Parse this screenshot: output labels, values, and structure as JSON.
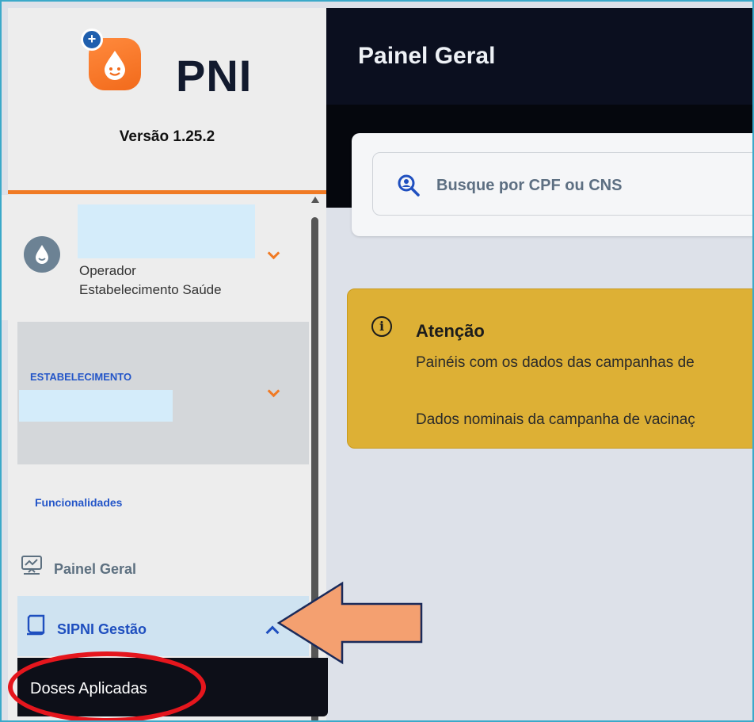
{
  "app": {
    "logo_text": "PNI",
    "version": "Versão 1.25.2"
  },
  "user": {
    "role_line1": "Operador",
    "role_line2": "Estabelecimento Saúde"
  },
  "establishment": {
    "title": "ESTABELECIMENTO"
  },
  "sidebar": {
    "section_title": "Funcionalidades",
    "items": [
      {
        "label": "Painel Geral",
        "icon": "dashboard-icon"
      },
      {
        "label": "SIPNI Gestão",
        "icon": "document-icon",
        "expanded": true
      },
      {
        "label": "Doses Aplicadas",
        "highlighted": true
      }
    ]
  },
  "header": {
    "title": "Painel Geral"
  },
  "search": {
    "placeholder": "Busque por CPF ou CNS",
    "icon": "person-search-icon"
  },
  "alert": {
    "title": "Atenção",
    "line1": "Painéis com os dados das campanhas de",
    "line2": "Dados nominais da campanha de vacinaç",
    "icon": "info-icon",
    "color": "#ddb035"
  },
  "colors": {
    "accent_orange": "#f07a24",
    "annotation_red": "#e5161d",
    "annotation_arrow": "#f4a070",
    "topbar": "#0b0f1f",
    "link_blue": "#2355c8"
  }
}
